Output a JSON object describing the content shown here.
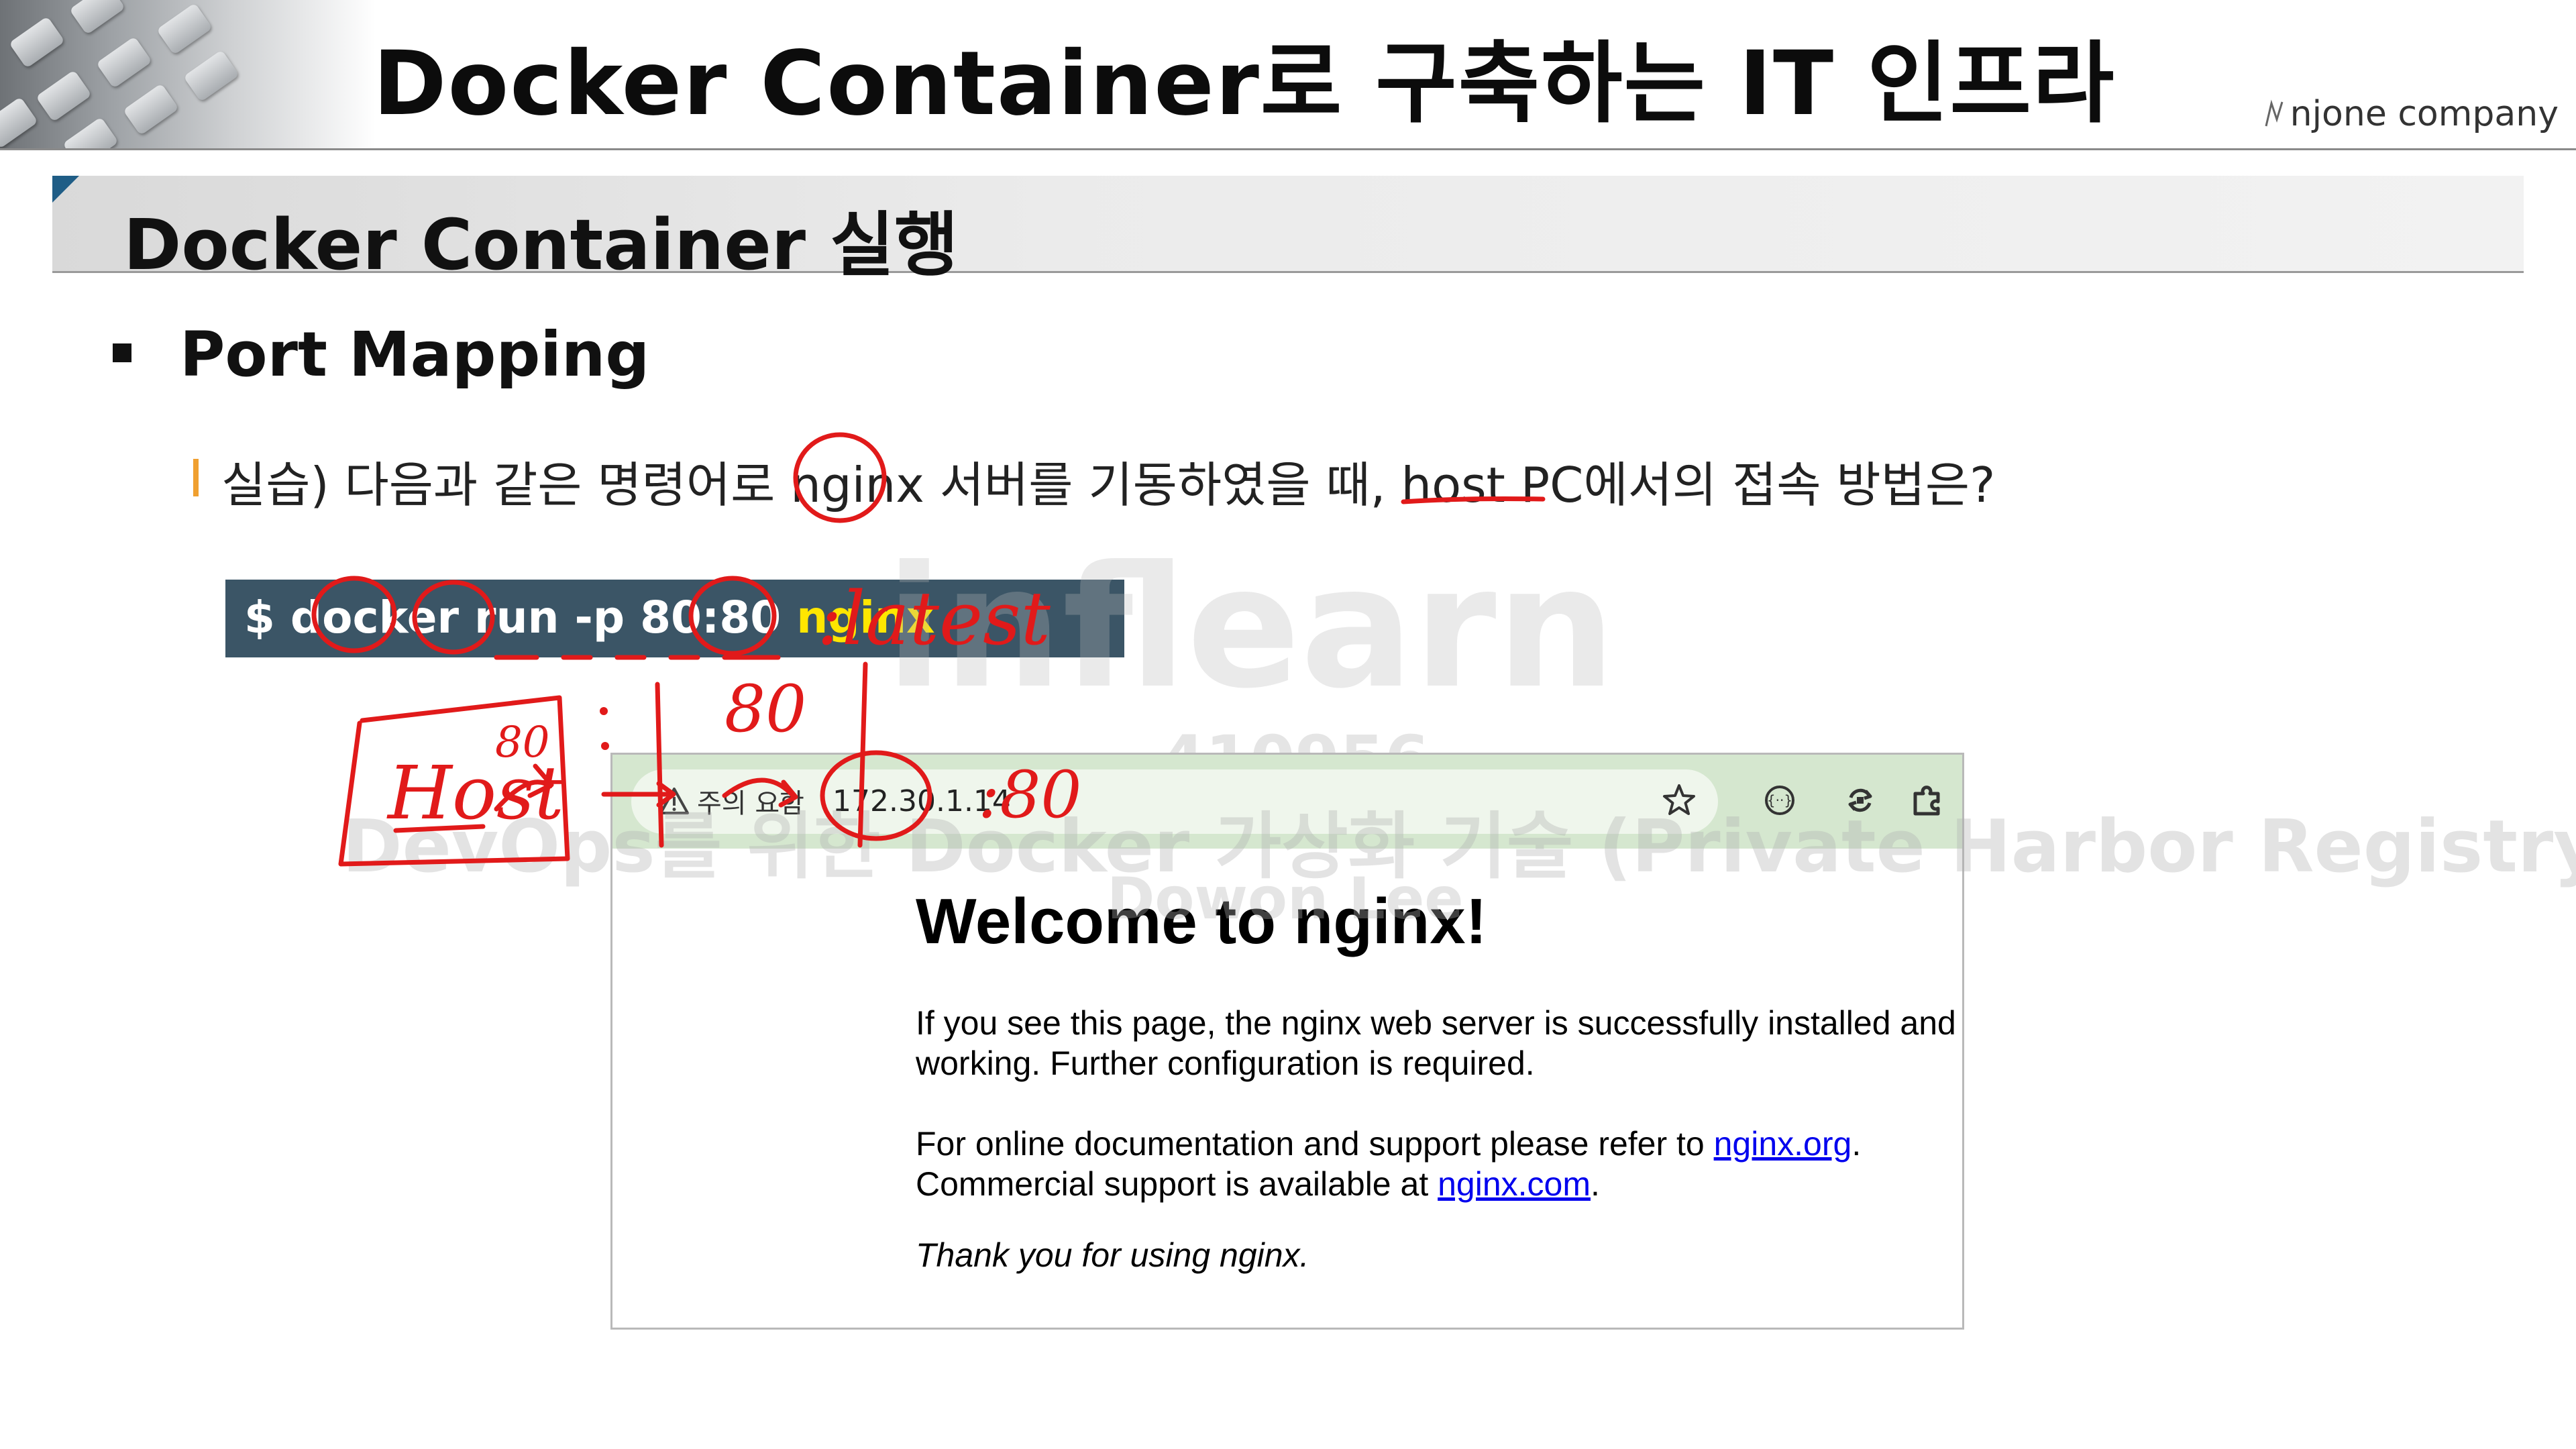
{
  "header": {
    "title": "Docker Container로 구축하는 IT 인프라",
    "brand": "njone company"
  },
  "section": {
    "title": "Docker Container 실행"
  },
  "bullet": {
    "title": "Port Mapping"
  },
  "question": {
    "text": "실습) 다음과 같은 명령어로 nginx 서버를 기동하였을 때, host PC에서의 접속 방법은?"
  },
  "command": {
    "prefix": "$ docker run -p 80:80 ",
    "image": "nginx"
  },
  "browser": {
    "security_label": "주의 요함",
    "url": "172.30.1.14",
    "icons": [
      "warning-icon",
      "star-icon",
      "extension-icon",
      "sync-icon",
      "puzzle-icon"
    ],
    "heading": "Welcome to nginx!",
    "para1_line1": "If you see this page, the nginx web server is successfully installed and",
    "para1_line2": "working. Further configuration is required.",
    "para2_line1_prefix": "For online documentation and support please refer to ",
    "para2_link1": "nginx.org",
    "para2_line1_suffix": ".",
    "para2_line2_prefix": "Commercial support is available at ",
    "para2_link2": "nginx.com",
    "para2_line2_suffix": ".",
    "para3": "Thank you for using nginx."
  },
  "watermark": {
    "logo": "inflearn",
    "id": "410956",
    "course": "DevOps를 위한 Docker 가상화 기술 (Private Harbor Registry)",
    "name": "Dowon Lee"
  },
  "annotations": {
    "tag": ":latest",
    "port_top": "80",
    "host": "Host",
    "host_port": "80",
    "url_port": ":80"
  },
  "colors": {
    "command_bg": "#3b5566",
    "command_highlight": "#ffe600",
    "annotation_ink": "#e11a1a",
    "browser_toolbar": "#d5e7cf",
    "link": "#0000ee",
    "question_marker": "#f0a030",
    "section_corner": "#1f5d86"
  }
}
